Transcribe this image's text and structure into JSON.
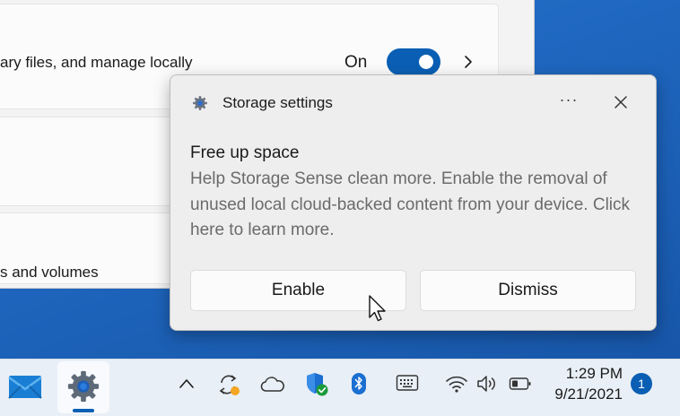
{
  "settings_window": {
    "storage_sense_desc": "ary files, and manage locally",
    "storage_sense_state": "On",
    "toggle_on": true,
    "disks_desc": "s and volumes"
  },
  "toast": {
    "app_name": "Storage settings",
    "more_label": "···",
    "title": "Free up space",
    "body": "Help Storage Sense clean more. Enable the removal of unused local cloud-backed content from your device. Click here to learn more.",
    "enable_label": "Enable",
    "dismiss_label": "Dismiss"
  },
  "taskbar": {
    "time": "1:29 PM",
    "date": "9/21/2021",
    "notification_count": "1",
    "icons": [
      "mail-icon",
      "settings-app-icon",
      "chevron-up-icon",
      "sync-icon",
      "onedrive-icon",
      "windows-security-icon",
      "bluetooth-icon",
      "keyboard-icon",
      "wifi-icon",
      "volume-icon",
      "battery-icon"
    ]
  },
  "colors": {
    "accent": "#0a5fb4",
    "wallpaper": "#1f67c0",
    "toast_bg": "#eeeeee",
    "security_green": "#1a9b3a",
    "sync_orange": "#f5a623"
  }
}
